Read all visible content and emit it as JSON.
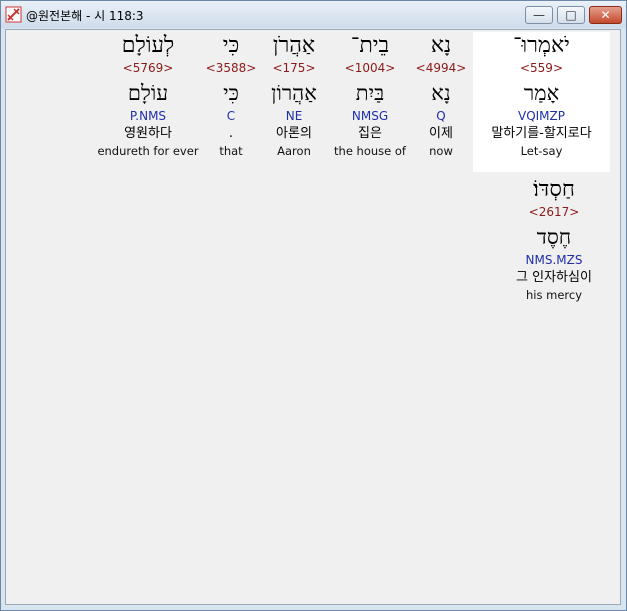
{
  "window": {
    "title": "@원전본해 - 시 118:3",
    "controls": {
      "minimize": "—",
      "maximize": "□",
      "close": "✕"
    },
    "icon": "bible-app-icon"
  },
  "words": [
    {
      "heb": "יֹאמְרוּ־",
      "strong": "<559>",
      "lemma": "אָמַר",
      "morph": "VQIMZP",
      "kor": "말하기를-할지로다",
      "eng": "Let-say",
      "highlight": true
    },
    {
      "heb": "נָא",
      "strong": "<4994>",
      "lemma": "נָא",
      "morph": "Q",
      "kor": "이제",
      "eng": "now"
    },
    {
      "heb": "בֵית־",
      "strong": "<1004>",
      "lemma": "בַּיִת",
      "morph": "NMSG",
      "kor": "집은",
      "eng": "the house of"
    },
    {
      "heb": "אַהֲרֹן",
      "strong": "<175>",
      "lemma": "אַהֲרוֹן",
      "morph": "NE",
      "kor": "아론의",
      "eng": "Aaron"
    },
    {
      "heb": "כִּי",
      "strong": "<3588>",
      "lemma": "כִּי",
      "morph": "C",
      "kor": ".",
      "eng": "that"
    },
    {
      "heb": "לְעוֹלָם",
      "strong": "<5769>",
      "lemma": "עוֹלָם",
      "morph": "P.NMS",
      "kor": "영원하다",
      "eng": "endureth for ever"
    },
    {
      "heb": "חַסְדּוֹ׃",
      "strong": "<2617>",
      "lemma": "חֶסֶד",
      "morph": "NMS.MZS",
      "kor": "그 인자하심이",
      "eng": "his mercy"
    }
  ]
}
